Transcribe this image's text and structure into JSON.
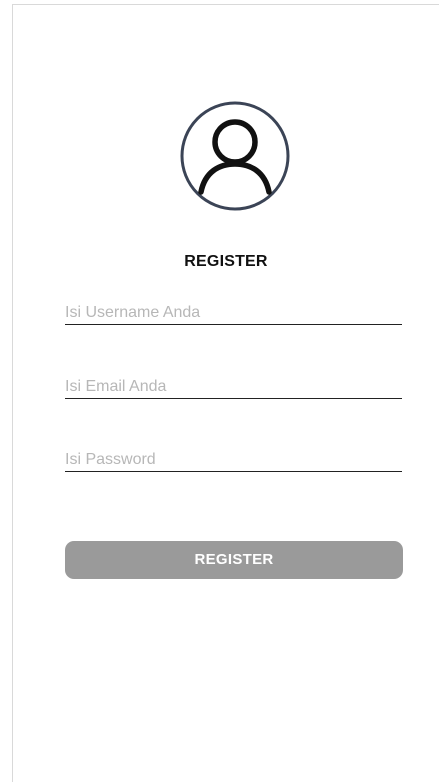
{
  "icons": {
    "avatar": "user-circle-icon"
  },
  "colors": {
    "button_background": "#9a9a9a",
    "button_text": "#ffffff",
    "input_underline": "#222222",
    "placeholder": "#b7b7b7",
    "avatar_ring": "#3b4456"
  },
  "register": {
    "title": "REGISTER",
    "username": {
      "value": "",
      "placeholder": "Isi Username Anda"
    },
    "email": {
      "value": "",
      "placeholder": "Isi Email Anda"
    },
    "password": {
      "value": "",
      "placeholder": "Isi Password"
    },
    "button_label": "REGISTER"
  }
}
